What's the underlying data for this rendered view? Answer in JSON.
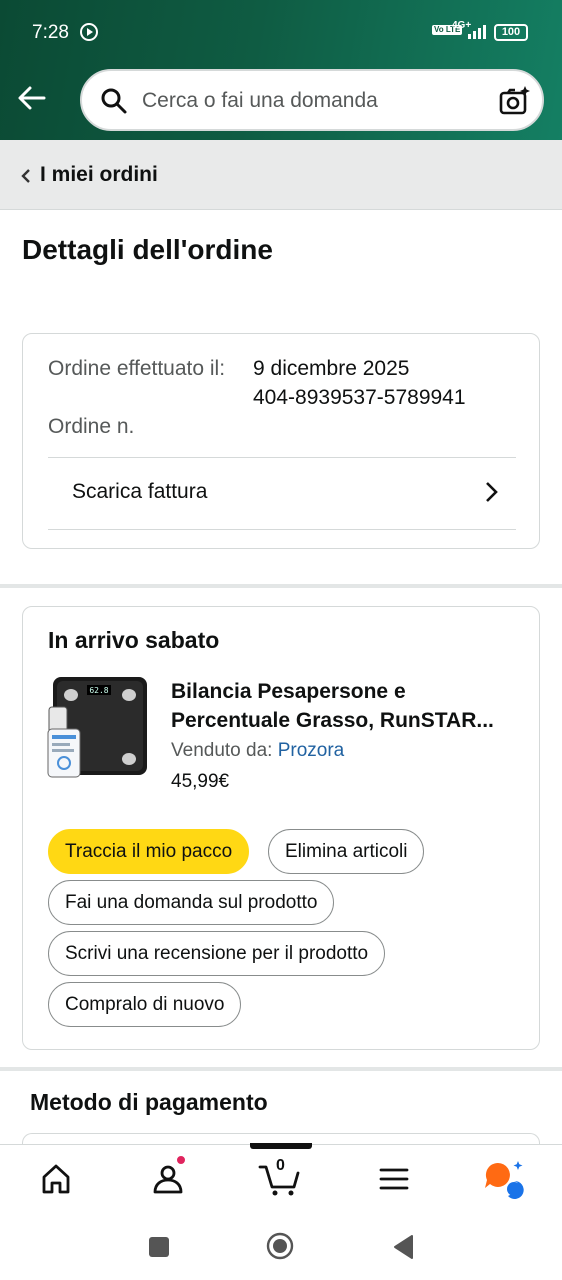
{
  "status_bar": {
    "time": "7:28",
    "volte": "Vo LTE",
    "network": "4G+",
    "battery": "100"
  },
  "search": {
    "placeholder": "Cerca o fai una domanda"
  },
  "breadcrumb": {
    "label": "I miei ordini"
  },
  "page": {
    "title": "Dettagli dell'ordine"
  },
  "order": {
    "date_label": "Ordine effettuato il:",
    "date_value": "9 dicembre 2025",
    "number_label": "Ordine n.",
    "number_value": "404-8939537-5789941",
    "invoice_label": "Scarica fattura"
  },
  "shipment": {
    "heading": "In arrivo sabato",
    "product_title_line1": "Bilancia Pesapersone e",
    "product_title_line2": "Percentuale Grasso, RunSTAR...",
    "seller_prefix": "Venduto da:",
    "seller_name": "Prozora",
    "price": "45,99€",
    "scale_display": "62.8",
    "actions": {
      "track": "Traccia il mio pacco",
      "delete": "Elimina articoli",
      "ask": "Fai una domanda sul prodotto",
      "review": "Scrivi una recensione per il prodotto",
      "rebuy": "Compralo di nuovo"
    }
  },
  "payment": {
    "heading": "Metodo di pagamento"
  },
  "tabbar": {
    "cart_count": "0"
  },
  "colors": {
    "header_dark": "#0b4a34",
    "header_light": "#147f63",
    "primary_button": "#ffd814",
    "link": "#2162a1",
    "notification_dot": "#e0245e",
    "rufus_orange": "#ff6a13",
    "rufus_blue": "#1a73e8"
  }
}
